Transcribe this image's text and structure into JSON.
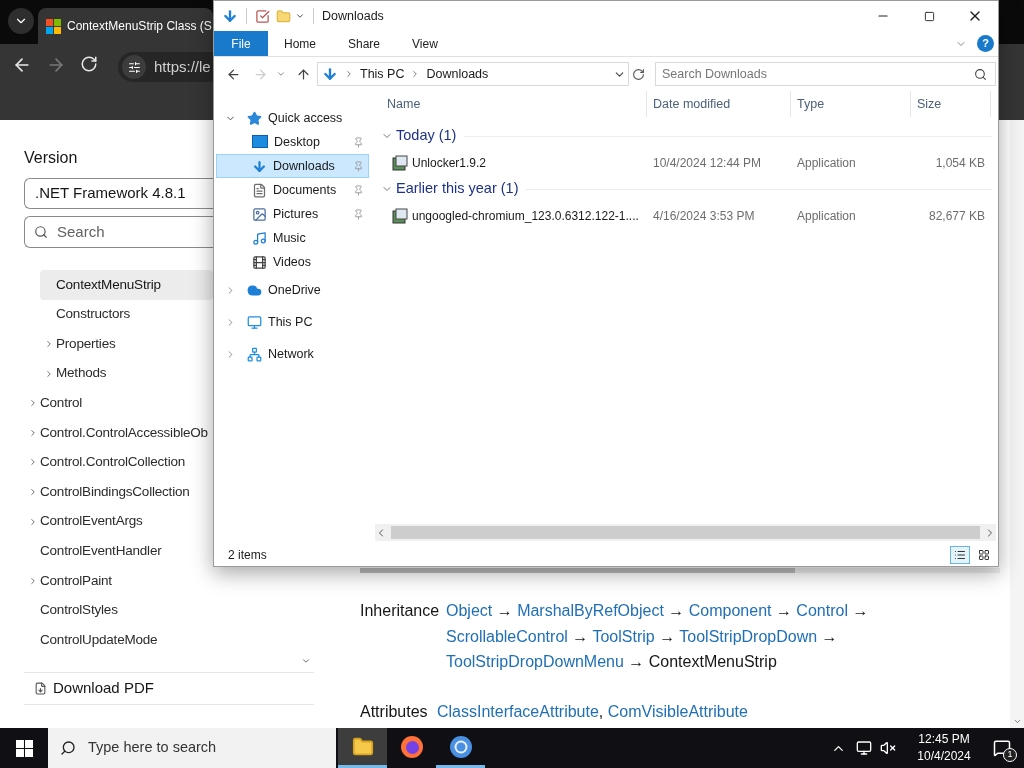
{
  "browser": {
    "tab_title": "ContextMenuStrip Class (S",
    "url": "https://le",
    "sidebar": {
      "version_label": "Version",
      "version_value": ".NET Framework 4.8.1",
      "search_placeholder": "Search",
      "tree": [
        {
          "children": [
            {
              "label": "ContextMenuStrip",
              "selected": true,
              "expandable": false
            },
            {
              "label": "Constructors",
              "selected": false,
              "expandable": false
            },
            {
              "label": "Properties",
              "selected": false,
              "expandable": true
            },
            {
              "label": "Methods",
              "selected": false,
              "expandable": true
            }
          ]
        },
        {
          "label": "Control",
          "selected": false,
          "expandable": true
        },
        {
          "label": "Control.ControlAccessibleOb",
          "selected": false,
          "expandable": true
        },
        {
          "label": "Control.ControlCollection",
          "selected": false,
          "expandable": true
        },
        {
          "label": "ControlBindingsCollection",
          "selected": false,
          "expandable": true
        },
        {
          "label": "ControlEventArgs",
          "selected": false,
          "expandable": true
        },
        {
          "label": "ControlEventHandler",
          "selected": false,
          "expandable": false
        },
        {
          "label": "ControlPaint",
          "selected": false,
          "expandable": true
        },
        {
          "label": "ControlStyles",
          "selected": false,
          "expandable": false
        },
        {
          "label": "ControlUpdateMode",
          "selected": false,
          "expandable": false
        }
      ],
      "download_label": "Download PDF"
    },
    "content": {
      "inheritance_label": "Inheritance",
      "inheritance_lines": [
        [
          {
            "text": "Object",
            "link": true
          },
          {
            "text": " → ",
            "link": false
          },
          {
            "text": "MarshalByRefObject",
            "link": true
          },
          {
            "text": " → ",
            "link": false
          },
          {
            "text": "Component",
            "link": true
          },
          {
            "text": " → ",
            "link": false
          },
          {
            "text": "Control",
            "link": true
          },
          {
            "text": " →",
            "link": false
          }
        ],
        [
          {
            "text": "ScrollableControl",
            "link": true
          },
          {
            "text": " → ",
            "link": false
          },
          {
            "text": "ToolStrip",
            "link": true
          },
          {
            "text": " → ",
            "link": false
          },
          {
            "text": "ToolStripDropDown",
            "link": true
          },
          {
            "text": " →",
            "link": false
          }
        ],
        [
          {
            "text": "ToolStripDropDownMenu",
            "link": true
          },
          {
            "text": " → ContextMenuStrip",
            "link": false
          }
        ]
      ],
      "attributes_label": "Attributes",
      "attributes": [
        {
          "text": "ClassInterfaceAttribute",
          "link": true
        },
        {
          "text": ", ",
          "link": false
        },
        {
          "text": "ComVisibleAttribute",
          "link": true
        }
      ]
    }
  },
  "explorer": {
    "title": "Downloads",
    "ribbon_tabs": [
      {
        "label": "File",
        "kind": "file"
      },
      {
        "label": "Home",
        "kind": "tab"
      },
      {
        "label": "Share",
        "kind": "tab"
      },
      {
        "label": "View",
        "kind": "tab"
      }
    ],
    "breadcrumb": [
      "This PC",
      "Downloads"
    ],
    "search_placeholder": "Search Downloads",
    "nav": [
      {
        "label": "Quick access",
        "kind": "star",
        "expanded": true,
        "selected": false,
        "children": [
          {
            "label": "Desktop",
            "kind": "desktop",
            "pinned": true,
            "selected": false
          },
          {
            "label": "Downloads",
            "kind": "download",
            "pinned": true,
            "selected": true
          },
          {
            "label": "Documents",
            "kind": "document",
            "pinned": true,
            "selected": false
          },
          {
            "label": "Pictures",
            "kind": "picture",
            "pinned": true,
            "selected": false
          },
          {
            "label": "Music",
            "kind": "music",
            "pinned": false,
            "selected": false
          },
          {
            "label": "Videos",
            "kind": "video",
            "pinned": false,
            "selected": false
          }
        ]
      },
      {
        "label": "OneDrive",
        "kind": "cloud",
        "expanded": false,
        "selected": false
      },
      {
        "label": "This PC",
        "kind": "computer",
        "expanded": false,
        "selected": false
      },
      {
        "label": "Network",
        "kind": "network",
        "expanded": false,
        "selected": false
      }
    ],
    "columns": [
      "Name",
      "Date modified",
      "Type",
      "Size"
    ],
    "groups": [
      {
        "label": "Today (1)",
        "expanded": true,
        "files": [
          {
            "name": "Unlocker1.9.2",
            "date": "10/4/2024 12:44 PM",
            "type": "Application",
            "size": "1,054 KB",
            "selected": false
          }
        ]
      },
      {
        "label": "Earlier this year (1)",
        "expanded": true,
        "files": [
          {
            "name": "ungoogled-chromium_123.0.6312.122-1....",
            "date": "4/16/2024 3:53 PM",
            "type": "Application",
            "size": "82,677 KB",
            "selected": false
          }
        ]
      }
    ],
    "help_label": "?",
    "status": "2 items",
    "view_modes": [
      {
        "kind": "details",
        "selected": true
      },
      {
        "kind": "tiles",
        "selected": false
      }
    ]
  },
  "taskbar": {
    "search_placeholder": "Type here to search",
    "apps": [
      {
        "kind": "explorer",
        "active": true,
        "open": true
      },
      {
        "kind": "firefox",
        "active": false,
        "open": false
      },
      {
        "kind": "chrome",
        "active": false,
        "open": true
      }
    ],
    "time": "12:45 PM",
    "date": "10/4/2024",
    "notifications": "1"
  }
}
